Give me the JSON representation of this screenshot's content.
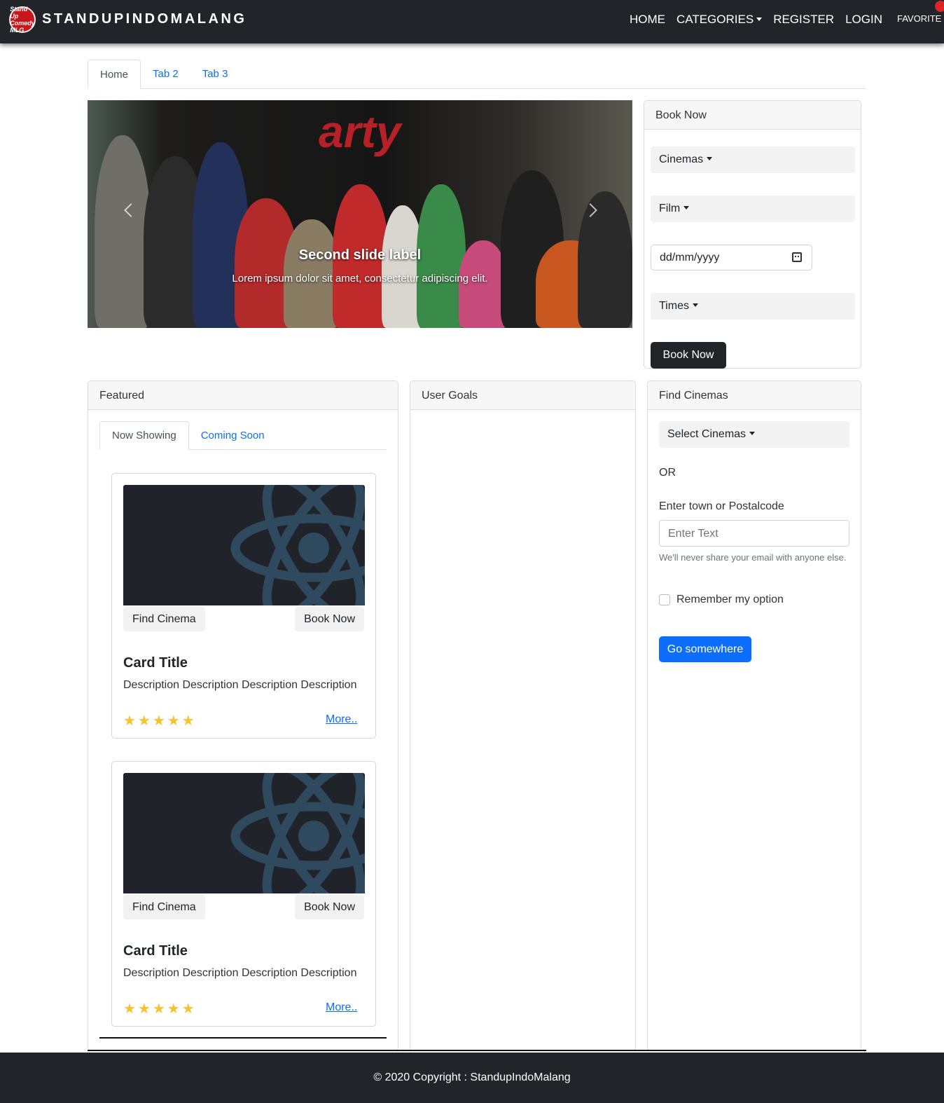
{
  "navbar": {
    "logo_text": "Stand Up Comedy MLG",
    "brand": "STANDUPINDOMALANG",
    "links": [
      "HOME",
      "CATEGORIES",
      "REGISTER",
      "LOGIN"
    ],
    "favorite": "FAVORITE"
  },
  "top_tabs": [
    "Home",
    "Tab 2",
    "Tab 3"
  ],
  "carousel": {
    "banner_text": "arty",
    "title": "Second slide label",
    "text": "Lorem ipsum dolor sit amet, consectetur adipiscing elit."
  },
  "book_now": {
    "header": "Book Now",
    "cinemas": "Cinemas",
    "film": "Film",
    "date_placeholder": "dd/mm/yyyy",
    "times": "Times",
    "button": "Book Now"
  },
  "featured": {
    "header": "Featured",
    "tabs": [
      "Now Showing",
      "Coming Soon"
    ],
    "movies": [
      {
        "find": "Find Cinema",
        "book": "Book Now",
        "title": "Card Title",
        "desc": "Description Description Description Description",
        "stars": "★★★★★",
        "rating": 5,
        "more": "More.."
      },
      {
        "find": "Find Cinema",
        "book": "Book Now",
        "title": "Card Title",
        "desc": "Description Description Description Description",
        "stars": "★★★★★",
        "rating": 5,
        "more": "More.."
      }
    ]
  },
  "user_goals": {
    "header": "User Goals"
  },
  "find_cinemas": {
    "header": "Find Cinemas",
    "select": "Select Cinemas",
    "or": "OR",
    "label": "Enter town or Postalcode",
    "placeholder": "Enter Text",
    "help": "We'll never share your email with anyone else.",
    "remember": "Remember my option",
    "button": "Go somewhere"
  },
  "footer": {
    "text": "© 2020 Copyright :  StandupIndoMalang"
  },
  "colors": {
    "navbar": "#212529",
    "primary": "#0d6efd",
    "star": "#f9c22b",
    "logo": "#c8161d"
  }
}
